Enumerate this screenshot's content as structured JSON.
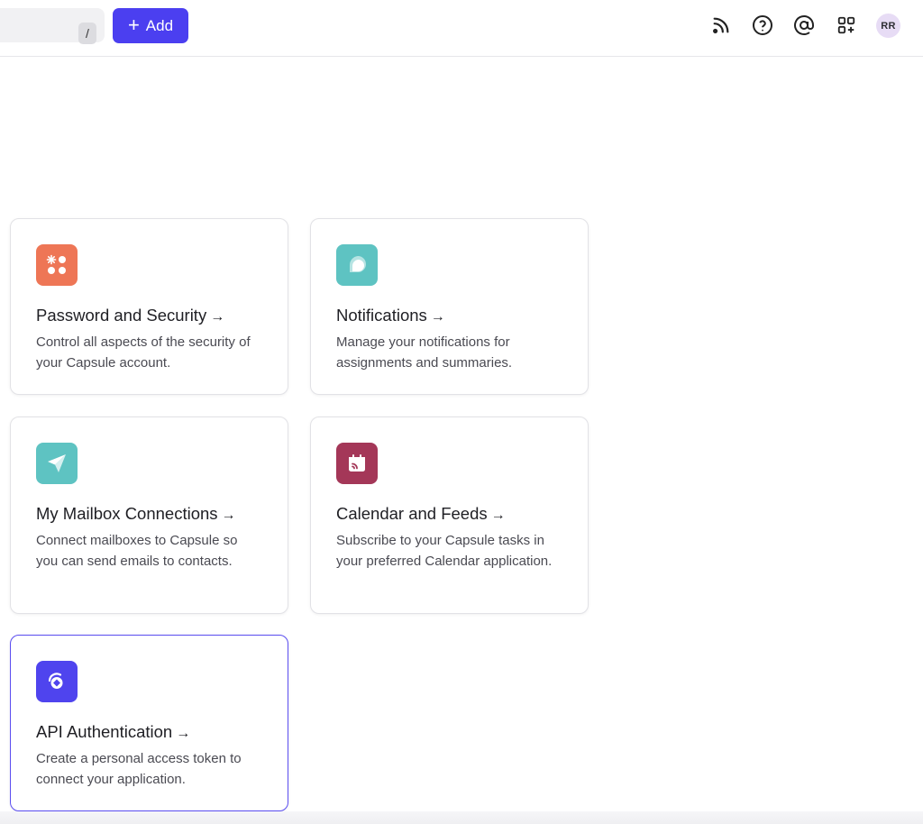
{
  "topbar": {
    "search_shortcut": "/",
    "add_label": "Add",
    "avatar_initials": "RR"
  },
  "cards": [
    {
      "title": "Password and Security",
      "arrow": "→",
      "description": "Control all aspects of the security of your Capsule account.",
      "icon": "asterisk-dots-icon",
      "color": "#ee7656"
    },
    {
      "title": "Notifications",
      "arrow": "→",
      "description": "Manage your notifications for assignments and summaries.",
      "icon": "speech-bubble-icon",
      "color": "#5ec3c2"
    },
    {
      "title": "My Mailbox Connections",
      "arrow": "→",
      "description": "Connect mailboxes to Capsule so you can send emails to contacts.",
      "icon": "paper-plane-icon",
      "color": "#5ec3c2"
    },
    {
      "title": "Calendar and Feeds",
      "arrow": "→",
      "description": "Subscribe to your Capsule tasks in your preferred Calendar application.",
      "icon": "calendar-feed-icon",
      "color": "#a43758"
    },
    {
      "title": "API Authentication",
      "arrow": "→",
      "description": "Create a personal access token to connect your application.",
      "icon": "api-key-icon",
      "color": "#4f44ee"
    }
  ],
  "colors": {
    "accent": "#4b3ff0",
    "active_border": "#5a4df0"
  }
}
